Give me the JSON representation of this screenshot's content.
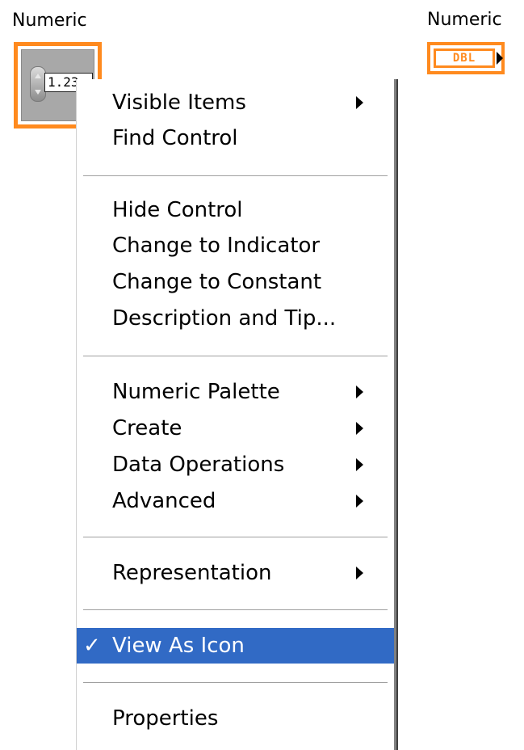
{
  "front_panel": {
    "label": "Numeric",
    "value": "1.23"
  },
  "block_diagram": {
    "label": "Numeric",
    "terminal_type": "DBL"
  },
  "menu": {
    "items": [
      {
        "label": "Visible Items",
        "submenu": true
      },
      {
        "label": "Find Control",
        "submenu": false
      },
      {
        "label": "Hide Control",
        "submenu": false
      },
      {
        "label": "Change to Indicator",
        "submenu": false
      },
      {
        "label": "Change to Constant",
        "submenu": false
      },
      {
        "label": "Description and Tip...",
        "submenu": false
      },
      {
        "label": "Numeric Palette",
        "submenu": true
      },
      {
        "label": "Create",
        "submenu": true
      },
      {
        "label": "Data Operations",
        "submenu": true
      },
      {
        "label": "Advanced",
        "submenu": true
      },
      {
        "label": "Representation",
        "submenu": true
      },
      {
        "label": "View As Icon",
        "checked": true,
        "check_glyph": "✓",
        "selected": true
      },
      {
        "label": "Properties",
        "submenu": false
      }
    ]
  },
  "colors": {
    "accent_orange": "#ff8a1e",
    "selection_blue": "#316ac5"
  }
}
